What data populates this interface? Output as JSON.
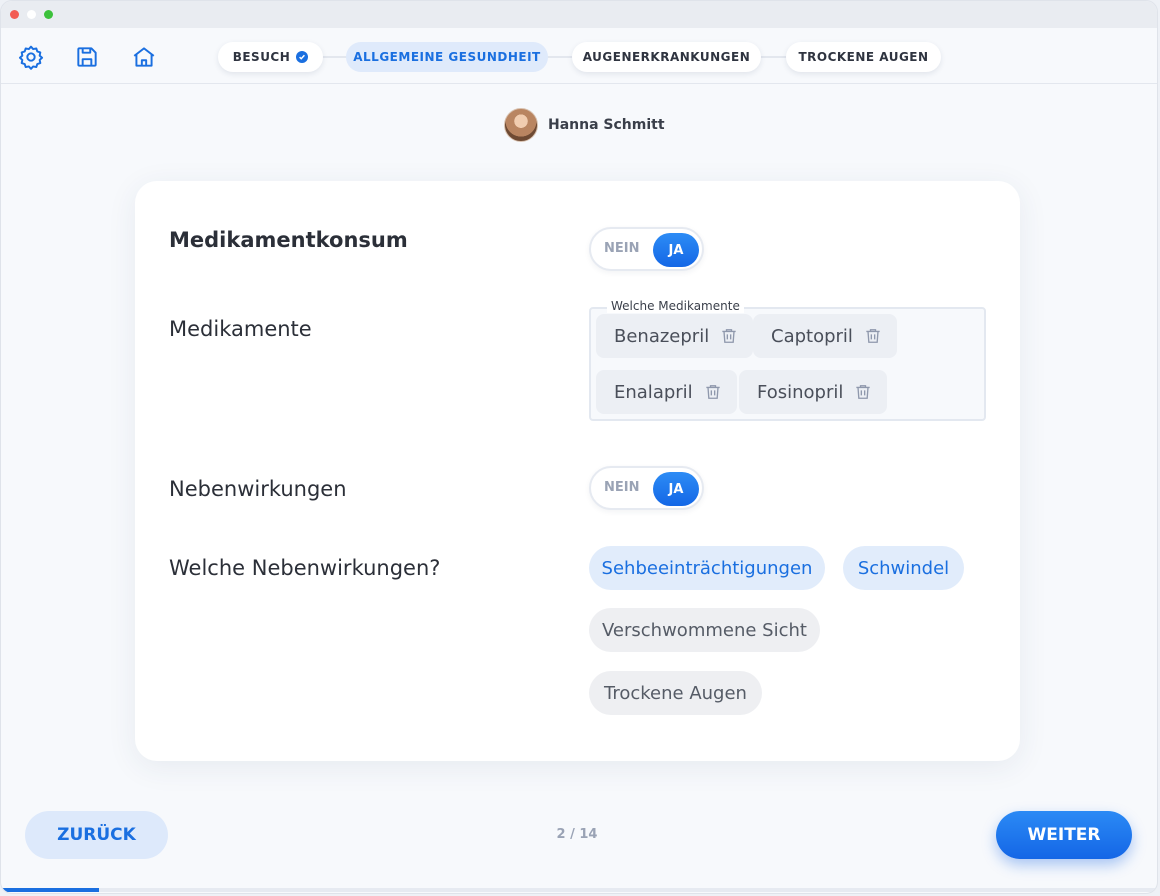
{
  "window": {
    "dots": [
      "#f25c54",
      "#e9ecf1",
      "#3cc13b"
    ]
  },
  "toolbar": {
    "icons": [
      "gear-icon",
      "save-icon",
      "home-icon"
    ],
    "steps": [
      {
        "label": "BESUCH",
        "completed": true,
        "active": false
      },
      {
        "label": "ALLGEMEINE GESUNDHEIT",
        "completed": false,
        "active": true
      },
      {
        "label": "AUGENERKRANKUNGEN",
        "completed": false,
        "active": false
      },
      {
        "label": "TROCKENE AUGEN",
        "completed": false,
        "active": false
      }
    ]
  },
  "user": {
    "name": "Hanna Schmitt"
  },
  "form": {
    "medikamentkonsum": {
      "label": "Medikamentkonsum",
      "toggle": {
        "off": "NEIN",
        "on": "JA",
        "value": "JA"
      }
    },
    "medikamente": {
      "label": "Medikamente",
      "legend": "Welche Medikamente",
      "items": [
        "Benazepril",
        "Captopril",
        "Enalapril",
        "Fosinopril"
      ]
    },
    "nebenwirkungen": {
      "label": "Nebenwirkungen",
      "toggle": {
        "off": "NEIN",
        "on": "JA",
        "value": "JA"
      }
    },
    "welche_nebenwirkungen": {
      "label": "Welche Nebenwirkungen?",
      "options": [
        {
          "label": "Sehbeeinträchtigungen",
          "selected": true
        },
        {
          "label": "Schwindel",
          "selected": true
        },
        {
          "label": "Verschwommene Sicht",
          "selected": false
        },
        {
          "label": "Trockene Augen",
          "selected": false
        }
      ]
    }
  },
  "footer": {
    "back": "ZURÜCK",
    "next": "WEITER",
    "page": "2 / 14",
    "progress": 0.085
  },
  "colors": {
    "accent": "#1a6fe0",
    "accent_light": "#e1ecfb",
    "chip_bg": "#eceff4"
  }
}
